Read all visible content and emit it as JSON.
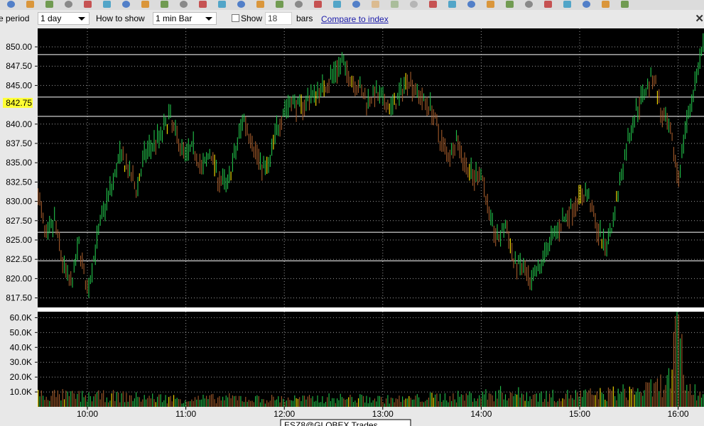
{
  "toolbar": {
    "icons": [
      "pointer-icon",
      "history-icon",
      "grid-icon",
      "open-icon",
      "save-icon",
      "print-icon",
      "copy-icon",
      "paste-icon",
      "image-icon",
      "close-icon",
      "zoom-icon",
      "zoom-reset-icon",
      "draw-icon",
      "erase-icon",
      "bar-chart-icon",
      "area-chart-icon",
      "crosshair-icon",
      "trendline-icon",
      "fibonacci-icon",
      "pitchfork-icon",
      "undo-icon",
      "redo-icon",
      "hline-icon",
      "vline-icon",
      "channel-icon",
      "ruler-icon",
      "zoom-in-icon",
      "zoom-out-icon",
      "scroll-left-icon",
      "scroll-right-icon",
      "palette-icon",
      "refresh-icon",
      "settings-icon"
    ]
  },
  "options": {
    "time_period_label": "e period",
    "time_period_value": "1 day",
    "how_to_show_label": "How to show",
    "how_to_show_value": "1 min Bar",
    "show_label": "Show",
    "show_value": "18",
    "bars_label": "bars",
    "compare_link": "Compare to index",
    "close_glyph": "✕"
  },
  "colors": {
    "up": "#22c24a",
    "down": "#a25a2a",
    "highlight": "#ffe400",
    "grid": "#9a9a9a",
    "level_line": "#ffffff",
    "chart_bg": "#000000",
    "current_price_bg": "#ffff33"
  },
  "chart_data": [
    {
      "type": "line",
      "ylim": [
        815.5,
        852
      ],
      "y_ticks": [
        "850.00",
        "847.50",
        "845.00",
        "842.75",
        "840.00",
        "837.50",
        "835.00",
        "832.50",
        "830.00",
        "827.50",
        "825.00",
        "822.50",
        "820.00",
        "817.50"
      ],
      "current_price": "842.75",
      "levels": [
        849.0,
        843.5,
        841.0,
        826.0,
        822.3
      ],
      "points": [
        [
          "09:30",
          831.0
        ],
        [
          "09:35",
          825.0
        ],
        [
          "09:40",
          827.5
        ],
        [
          "09:45",
          822.0
        ],
        [
          "09:50",
          819.0
        ],
        [
          "09:55",
          824.5
        ],
        [
          "10:00",
          818.0
        ],
        [
          "10:05",
          824.0
        ],
        [
          "10:10",
          829.0
        ],
        [
          "10:15",
          832.0
        ],
        [
          "10:20",
          836.0
        ],
        [
          "10:25",
          834.0
        ],
        [
          "10:30",
          831.5
        ],
        [
          "10:35",
          836.0
        ],
        [
          "10:40",
          837.5
        ],
        [
          "10:45",
          838.5
        ],
        [
          "10:50",
          841.0
        ],
        [
          "10:55",
          838.0
        ],
        [
          "11:00",
          836.0
        ],
        [
          "11:05",
          837.0
        ],
        [
          "11:10",
          834.0
        ],
        [
          "11:15",
          836.5
        ],
        [
          "11:20",
          833.0
        ],
        [
          "11:25",
          832.0
        ],
        [
          "11:30",
          836.0
        ],
        [
          "11:35",
          841.0
        ],
        [
          "11:40",
          838.0
        ],
        [
          "11:45",
          835.0
        ],
        [
          "11:50",
          834.0
        ],
        [
          "11:55",
          839.0
        ],
        [
          "12:00",
          842.0
        ],
        [
          "12:05",
          843.0
        ],
        [
          "12:10",
          842.0
        ],
        [
          "12:15",
          843.5
        ],
        [
          "12:20",
          844.0
        ],
        [
          "12:25",
          845.0
        ],
        [
          "12:30",
          846.5
        ],
        [
          "12:35",
          848.0
        ],
        [
          "12:40",
          846.0
        ],
        [
          "12:45",
          845.0
        ],
        [
          "12:50",
          843.0
        ],
        [
          "12:55",
          844.0
        ],
        [
          "13:00",
          843.0
        ],
        [
          "13:05",
          842.0
        ],
        [
          "13:10",
          843.5
        ],
        [
          "13:15",
          846.0
        ],
        [
          "13:20",
          844.5
        ],
        [
          "13:25",
          843.0
        ],
        [
          "13:30",
          842.0
        ],
        [
          "13:35",
          838.0
        ],
        [
          "13:40",
          836.0
        ],
        [
          "13:45",
          838.0
        ],
        [
          "13:50",
          835.0
        ],
        [
          "13:55",
          833.0
        ],
        [
          "14:00",
          834.0
        ],
        [
          "14:05",
          828.0
        ],
        [
          "14:10",
          825.0
        ],
        [
          "14:15",
          827.0
        ],
        [
          "14:20",
          822.0
        ],
        [
          "14:25",
          821.5
        ],
        [
          "14:30",
          819.0
        ],
        [
          "14:35",
          821.0
        ],
        [
          "14:40",
          824.0
        ],
        [
          "14:45",
          826.0
        ],
        [
          "14:50",
          827.5
        ],
        [
          "14:55",
          829.0
        ],
        [
          "15:00",
          830.5
        ],
        [
          "15:05",
          831.0
        ],
        [
          "15:10",
          827.0
        ],
        [
          "15:15",
          824.0
        ],
        [
          "15:20",
          827.0
        ],
        [
          "15:25",
          833.0
        ],
        [
          "15:30",
          838.5
        ],
        [
          "15:35",
          842.0
        ],
        [
          "15:40",
          844.5
        ],
        [
          "15:45",
          846.5
        ],
        [
          "15:50",
          841.0
        ],
        [
          "15:55",
          839.0
        ],
        [
          "16:00",
          833.0
        ],
        [
          "16:05",
          840.0
        ],
        [
          "16:10",
          845.0
        ],
        [
          "16:15",
          850.0
        ],
        [
          "16:20",
          848.5
        ],
        [
          "16:25",
          847.5
        ],
        [
          "16:30",
          851.0
        ]
      ]
    },
    {
      "type": "bar",
      "ylim": [
        0,
        64000
      ],
      "y_ticks": [
        "60.0K",
        "50.0K",
        "40.0K",
        "30.0K",
        "20.0K",
        "10.0K"
      ],
      "x_ticks": [
        "10:00",
        "11:00",
        "12:00",
        "13:00",
        "14:00",
        "15:00",
        "16:00"
      ],
      "values": [
        [
          "09:30",
          9500
        ],
        [
          "09:45",
          9000
        ],
        [
          "10:00",
          8000
        ],
        [
          "10:15",
          8500
        ],
        [
          "10:30",
          7500
        ],
        [
          "10:45",
          7000
        ],
        [
          "11:00",
          6000
        ],
        [
          "11:15",
          6500
        ],
        [
          "11:30",
          7000
        ],
        [
          "11:45",
          6000
        ],
        [
          "12:00",
          6500
        ],
        [
          "12:15",
          6000
        ],
        [
          "12:30",
          7000
        ],
        [
          "12:45",
          6500
        ],
        [
          "13:00",
          6000
        ],
        [
          "13:15",
          6000
        ],
        [
          "13:30",
          7500
        ],
        [
          "13:45",
          8000
        ],
        [
          "14:00",
          9000
        ],
        [
          "14:15",
          11000
        ],
        [
          "14:30",
          9000
        ],
        [
          "14:45",
          8500
        ],
        [
          "15:00",
          9500
        ],
        [
          "15:15",
          10000
        ],
        [
          "15:30",
          12000
        ],
        [
          "15:45",
          14000
        ],
        [
          "15:55",
          22000
        ],
        [
          "16:00",
          62000
        ],
        [
          "16:05",
          15000
        ],
        [
          "16:15",
          9000
        ],
        [
          "16:30",
          8000
        ]
      ]
    }
  ],
  "bottom_label": "ESZ8@GLOBEX Trades"
}
